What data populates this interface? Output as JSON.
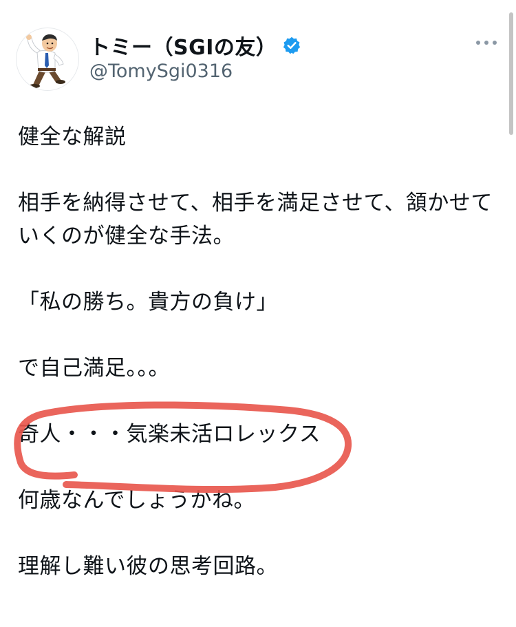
{
  "author": {
    "display_name": "トミー（SGIの友）",
    "handle": "@TomySgi0316",
    "verified_icon": "verified-badge-icon",
    "verified_color": "#1d9bf0"
  },
  "more_icon": "more-horizontal-icon",
  "tweet": {
    "line1": "健全な解説",
    "line2": "相手を納得させて、相手を満足させて、頷かせて",
    "line3": "いくのが健全な手法。",
    "line4": "「私の勝ち。貴方の負け」",
    "line5": "で自己満足。。。",
    "line6": "奇人・・・気楽未活ロレックス",
    "line7": "何歳なんでしょうかね。",
    "line8": "理解し難い彼の思考回路。"
  },
  "annotation_color": "#e8544a"
}
